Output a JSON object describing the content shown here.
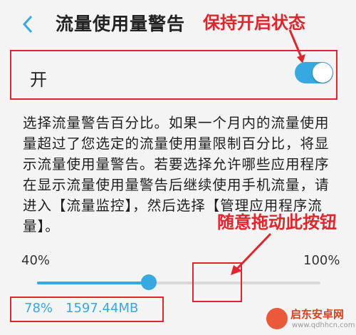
{
  "header": {
    "title": "流量使用量警告"
  },
  "annotations": {
    "toggle_hint": "保持开启状态",
    "slider_hint": "随意拖动此按钮"
  },
  "switch": {
    "label": "开",
    "on": true
  },
  "description": "选择流量警告百分比。如果一个月内的流量使用量超过了您选定的流量使用量限制百分比，将显示流量使用量警告。若要选择允许哪些应用程序在显示流量使用量警告后继续使用手机流量，请进入【流量监控】，然后选择【管理应用程序流量】。",
  "slider": {
    "min_label": "40%",
    "max_label": "100%",
    "min": 40,
    "max": 100,
    "value": 78
  },
  "readout": {
    "percent": "78%",
    "amount": "1597.44MB"
  },
  "colors": {
    "accent": "#38a8e1",
    "annotation": "#e0262c"
  },
  "watermark": {
    "title": "启东安卓网",
    "url": "www.qdhhcn.com"
  }
}
